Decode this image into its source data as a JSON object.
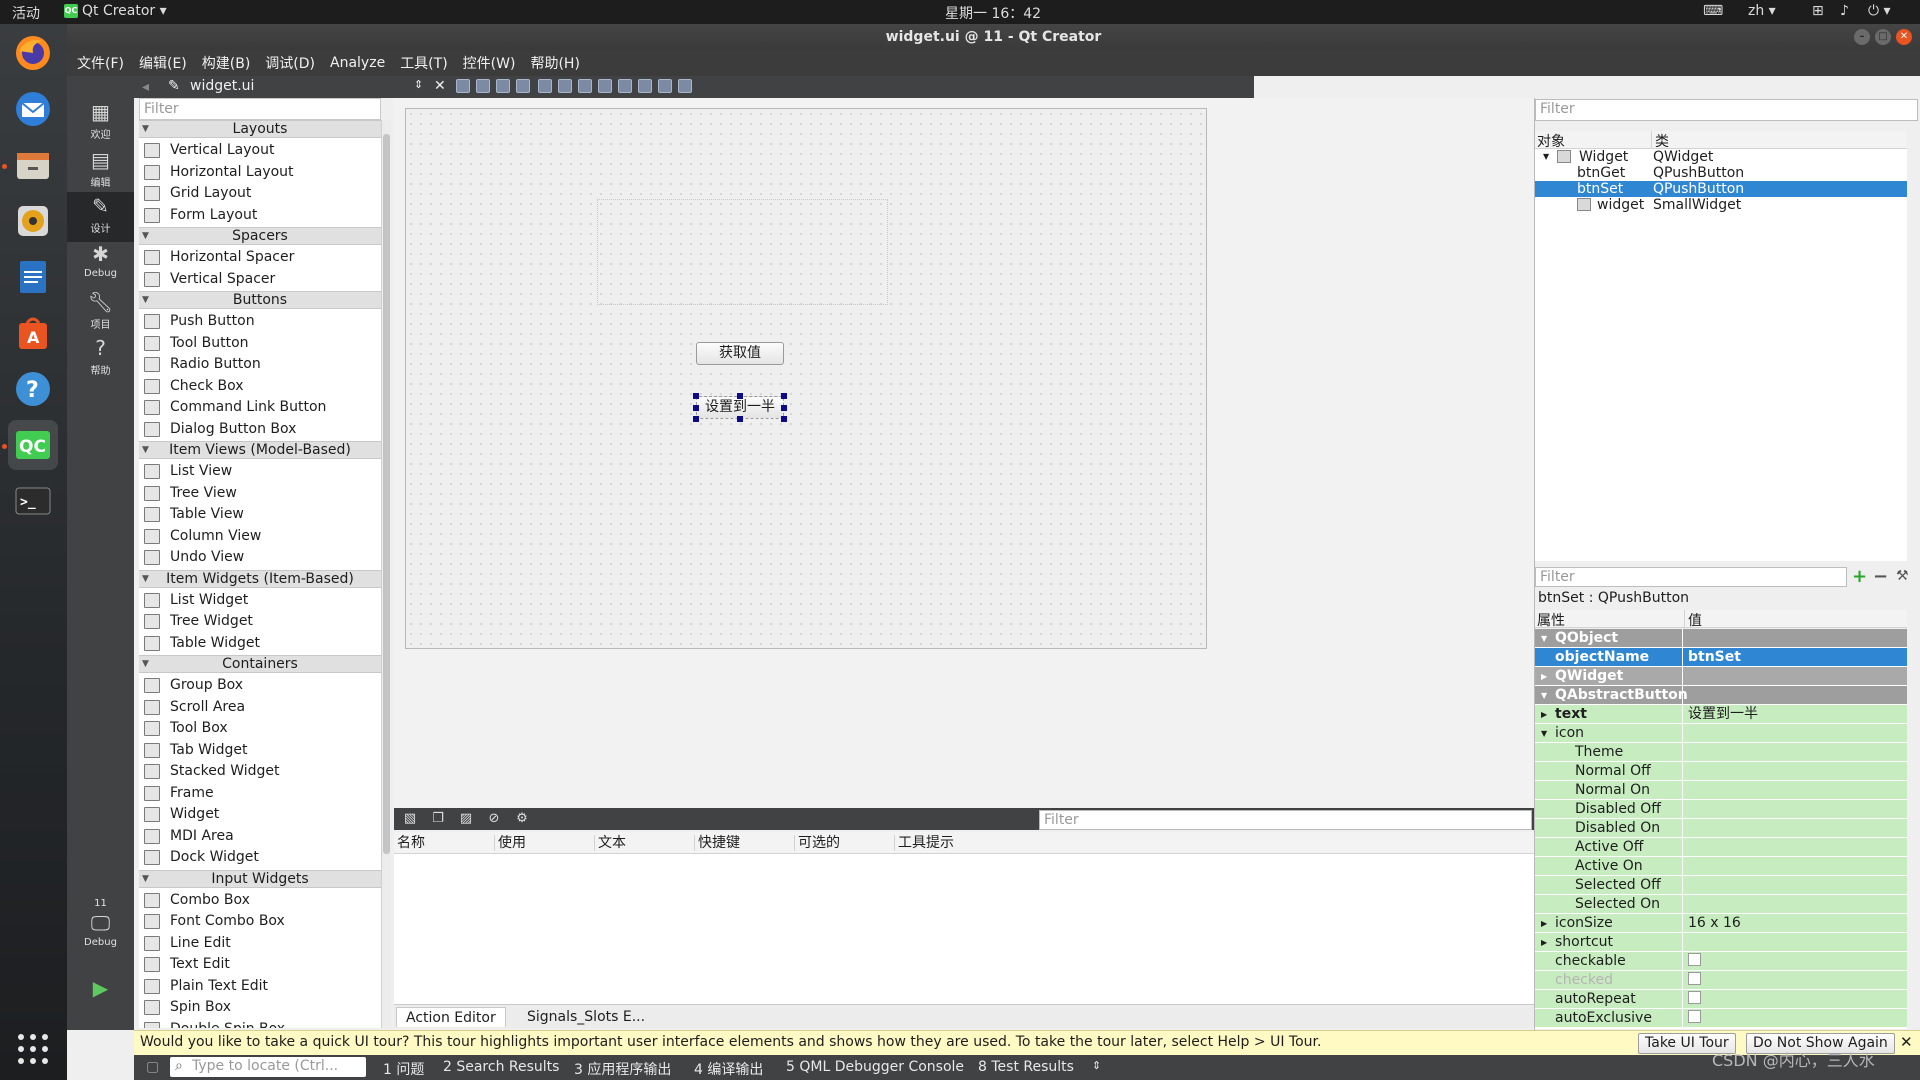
{
  "system_bar": {
    "activities": "活动",
    "app_name": "Qt Creator",
    "clock": "星期一 16：42",
    "input_method": "zh"
  },
  "window": {
    "title": "widget.ui @ 11 - Qt Creator"
  },
  "menu": [
    "文件(F)",
    "编辑(E)",
    "构建(B)",
    "调试(D)",
    "Analyze",
    "工具(T)",
    "控件(W)",
    "帮助(H)"
  ],
  "modes": [
    {
      "label": "欢迎",
      "icon": "grid-icon"
    },
    {
      "label": "编辑",
      "icon": "edit-doc-icon"
    },
    {
      "label": "设计",
      "icon": "pencil-icon"
    },
    {
      "label": "Debug",
      "icon": "bug-icon"
    },
    {
      "label": "项目",
      "icon": "wrench-icon"
    },
    {
      "label": "帮助",
      "icon": "help-icon"
    }
  ],
  "build_target": {
    "project": "11",
    "config": "Debug"
  },
  "editor": {
    "open_file": "widget.ui"
  },
  "widget_box": {
    "filter_placeholder": "Filter",
    "categories": [
      {
        "name": "Layouts",
        "items": [
          "Vertical Layout",
          "Horizontal Layout",
          "Grid Layout",
          "Form Layout"
        ]
      },
      {
        "name": "Spacers",
        "items": [
          "Horizontal Spacer",
          "Vertical Spacer"
        ]
      },
      {
        "name": "Buttons",
        "items": [
          "Push Button",
          "Tool Button",
          "Radio Button",
          "Check Box",
          "Command Link Button",
          "Dialog Button Box"
        ]
      },
      {
        "name": "Item Views (Model-Based)",
        "items": [
          "List View",
          "Tree View",
          "Table View",
          "Column View",
          "Undo View"
        ]
      },
      {
        "name": "Item Widgets (Item-Based)",
        "items": [
          "List Widget",
          "Tree Widget",
          "Table Widget"
        ]
      },
      {
        "name": "Containers",
        "items": [
          "Group Box",
          "Scroll Area",
          "Tool Box",
          "Tab Widget",
          "Stacked Widget",
          "Frame",
          "Widget",
          "MDI Area",
          "Dock Widget"
        ]
      },
      {
        "name": "Input Widgets",
        "items": [
          "Combo Box",
          "Font Combo Box",
          "Line Edit",
          "Text Edit",
          "Plain Text Edit",
          "Spin Box",
          "Double Spin Box"
        ]
      }
    ]
  },
  "form": {
    "btn_get": "获取值",
    "btn_set": "设置到一半"
  },
  "action_editor": {
    "filter_placeholder": "Filter",
    "columns": [
      "名称",
      "使用",
      "文本",
      "快捷键",
      "可选的",
      "工具提示"
    ],
    "tabs": [
      "Action Editor",
      "Signals_Slots E..."
    ]
  },
  "object_inspector": {
    "filter_placeholder": "Filter",
    "columns": [
      "对象",
      "类"
    ],
    "rows": [
      {
        "object": "Widget",
        "class": "QWidget",
        "level": 0,
        "selected": false
      },
      {
        "object": "btnGet",
        "class": "QPushButton",
        "level": 1,
        "selected": false
      },
      {
        "object": "btnSet",
        "class": "QPushButton",
        "level": 1,
        "selected": true
      },
      {
        "object": "widget",
        "class": "SmallWidget",
        "level": 1,
        "selected": false
      }
    ]
  },
  "property_editor": {
    "filter_placeholder": "Filter",
    "header": "btnSet : QPushButton",
    "columns": [
      "属性",
      "值"
    ],
    "rows": [
      {
        "name": "QObject",
        "value": "",
        "kind": "group",
        "arrow": "▼"
      },
      {
        "name": "objectName",
        "value": "btnSet",
        "kind": "sel",
        "arrow": ""
      },
      {
        "name": "QWidget",
        "value": "",
        "kind": "group2",
        "arrow": "▶"
      },
      {
        "name": "QAbstractButton",
        "value": "",
        "kind": "group",
        "arrow": "▼"
      },
      {
        "name": "text",
        "value": "设置到一半",
        "kind": "bold",
        "arrow": "▶"
      },
      {
        "name": "icon",
        "value": "",
        "kind": "norm",
        "arrow": "▼"
      },
      {
        "name": "Theme",
        "value": "",
        "kind": "sub",
        "arrow": ""
      },
      {
        "name": "Normal Off",
        "value": "",
        "kind": "sub",
        "arrow": ""
      },
      {
        "name": "Normal On",
        "value": "",
        "kind": "sub",
        "arrow": ""
      },
      {
        "name": "Disabled Off",
        "value": "",
        "kind": "sub",
        "arrow": ""
      },
      {
        "name": "Disabled On",
        "value": "",
        "kind": "sub",
        "arrow": ""
      },
      {
        "name": "Active Off",
        "value": "",
        "kind": "sub",
        "arrow": ""
      },
      {
        "name": "Active On",
        "value": "",
        "kind": "sub",
        "arrow": ""
      },
      {
        "name": "Selected Off",
        "value": "",
        "kind": "sub",
        "arrow": ""
      },
      {
        "name": "Selected On",
        "value": "",
        "kind": "sub",
        "arrow": ""
      },
      {
        "name": "iconSize",
        "value": "16 x 16",
        "kind": "norm",
        "arrow": "▶"
      },
      {
        "name": "shortcut",
        "value": "",
        "kind": "norm",
        "arrow": "▶"
      },
      {
        "name": "checkable",
        "value": "",
        "kind": "check",
        "arrow": ""
      },
      {
        "name": "checked",
        "value": "",
        "kind": "check-disabled",
        "arrow": ""
      },
      {
        "name": "autoRepeat",
        "value": "",
        "kind": "check",
        "arrow": ""
      },
      {
        "name": "autoExclusive",
        "value": "",
        "kind": "check",
        "arrow": ""
      }
    ]
  },
  "tour_bar": {
    "message": "Would you like to take a quick UI tour? This tour highlights important user interface elements and shows how they are used. To take the tour later, select Help > UI Tour.",
    "take_tour": "Take UI Tour",
    "dont_show": "Do Not Show Again"
  },
  "status_bar": {
    "locate_placeholder": "Type to locate (Ctrl...",
    "items": [
      "1 问题",
      "2 Search Results",
      "3 应用程序输出",
      "4 编译输出",
      "5 QML Debugger Console",
      "8 Test Results"
    ]
  },
  "watermark": "CSDN @内心，三人水",
  "colors": {
    "selection": "#2f86d2",
    "accent": "#41cd52",
    "ubuntu_orange": "#e95420"
  }
}
